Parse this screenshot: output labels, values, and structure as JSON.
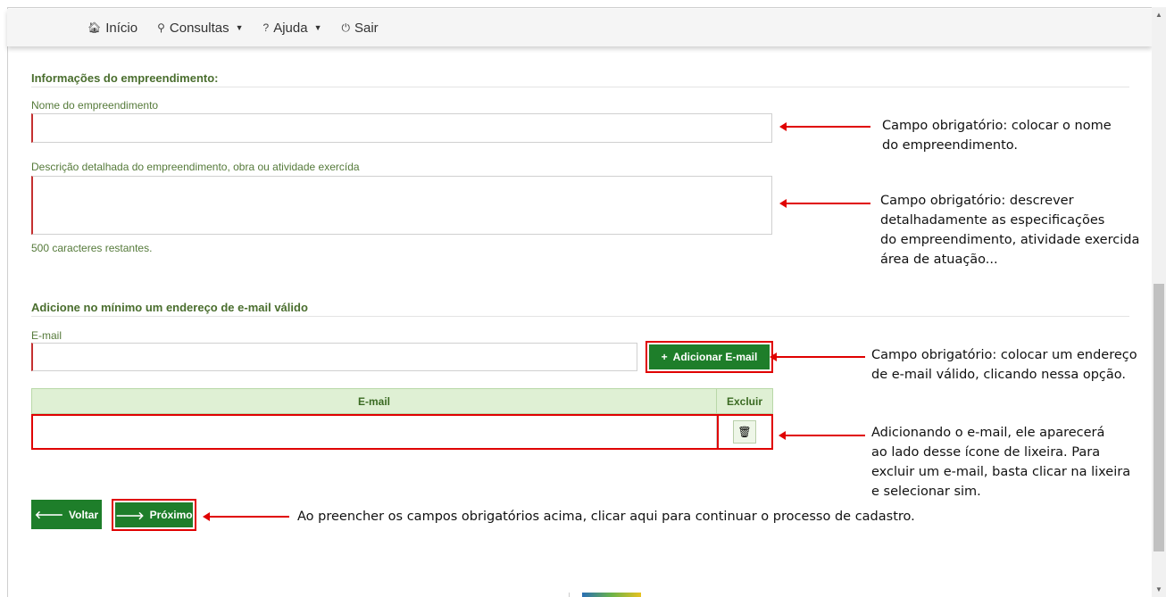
{
  "nav": {
    "items": [
      {
        "icon": "home-icon",
        "glyph": "🏠︎",
        "label": "Início",
        "dropdown": false
      },
      {
        "icon": "search-icon",
        "glyph": "⚲",
        "label": "Consultas",
        "dropdown": true
      },
      {
        "icon": "help-icon",
        "glyph": "?",
        "label": "Ajuda",
        "dropdown": true
      },
      {
        "icon": "power-icon",
        "glyph": "⏻",
        "label": "Sair",
        "dropdown": false
      }
    ]
  },
  "form": {
    "section_info_title": "Informações do empreendimento:",
    "name_label": "Nome do empreendimento",
    "name_value": "",
    "desc_label": "Descrição detalhada do empreendimento, obra ou atividade exercída",
    "desc_value": "",
    "desc_counter": "500 caracteres restantes.",
    "section_email_title": "Adicione no mínimo um endereço de e-mail válido",
    "email_label": "E-mail",
    "email_value": "",
    "add_email_button": "Adicionar E-mail",
    "table": {
      "headers": [
        "E-mail",
        "Excluir"
      ],
      "rows": [
        {
          "email": ""
        }
      ]
    },
    "back_button": "Voltar",
    "next_button": "Próximo"
  },
  "annotations": {
    "name_note": "Campo obrigatório: colocar o nome\ndo empreendimento.",
    "desc_note": "Campo obrigatório: descrever\ndetalhadamente as especificações\ndo empreendimento, atividade exercida\nárea de atuação...",
    "email_note": "Campo obrigatório: colocar um endereço\nde e-mail válido, clicando nessa opção.",
    "trash_note": "Adicionando o e-mail, ele aparecerá\nao lado desse ícone de lixeira. Para\nexcluir um e-mail, basta clicar na lixeira\ne selecionar sim.",
    "next_note": "Ao preencher os campos obrigatórios acima, clicar aqui para continuar o processo de cadastro."
  },
  "colors": {
    "accent_green": "#1e7e2a",
    "label_green": "#557a3a",
    "annotation_red": "#e00000"
  }
}
